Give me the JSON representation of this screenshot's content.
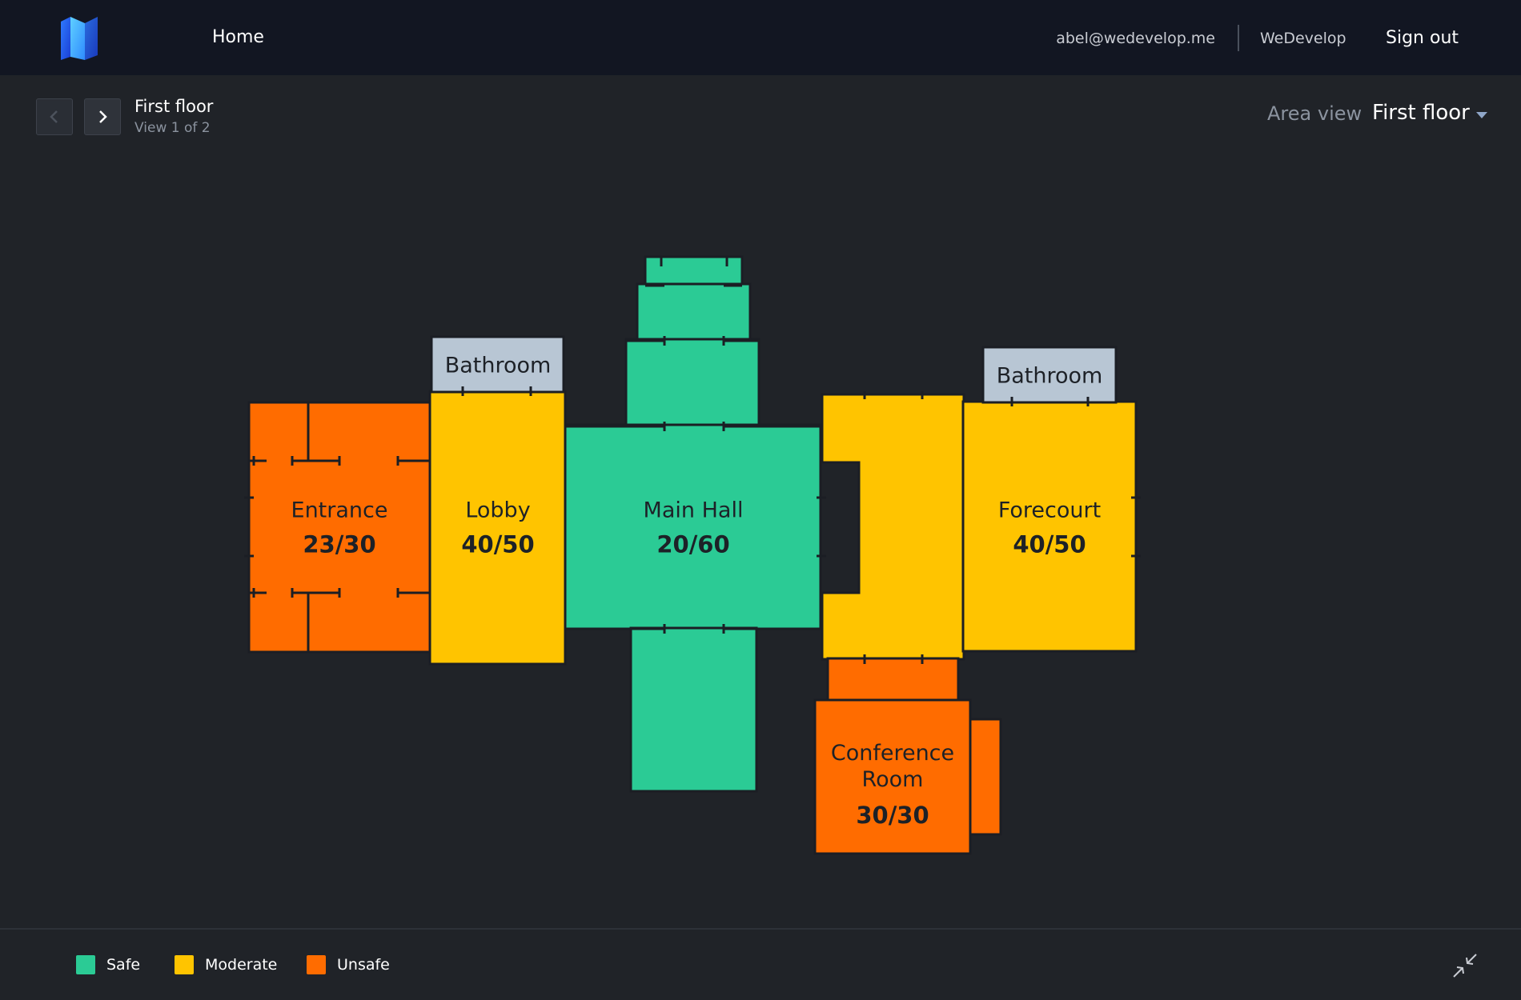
{
  "header": {
    "nav_home": "Home",
    "user_email": "abel@wedevelop.me",
    "org_name": "WeDevelop",
    "sign_out": "Sign out"
  },
  "floor_nav": {
    "title": "First floor",
    "subtitle": "View 1 of 2",
    "area_view_label": "Area view",
    "selected_floor": "First floor"
  },
  "colors": {
    "safe": "#2bcb95",
    "moderate": "#ffc400",
    "unsafe": "#ff6c00",
    "bathroom": "#b8c6d4",
    "background": "#202328",
    "topbar": "#121622"
  },
  "rooms": [
    {
      "id": "entrance",
      "name": "Entrance",
      "count": "23/30",
      "status": "unsafe"
    },
    {
      "id": "lobby",
      "name": "Lobby",
      "count": "40/50",
      "status": "moderate"
    },
    {
      "id": "main-hall",
      "name": "Main Hall",
      "count": "20/60",
      "status": "safe"
    },
    {
      "id": "forecourt",
      "name": "Forecourt",
      "count": "40/50",
      "status": "moderate"
    },
    {
      "id": "conference-room",
      "name": "Conference Room",
      "name_line1": "Conference",
      "name_line2": "Room",
      "count": "30/30",
      "status": "unsafe"
    },
    {
      "id": "bathroom-left",
      "name": "Bathroom",
      "status": "neutral"
    },
    {
      "id": "bathroom-right",
      "name": "Bathroom",
      "status": "neutral"
    }
  ],
  "legend": [
    {
      "label": "Safe",
      "color": "#2bcb95"
    },
    {
      "label": "Moderate",
      "color": "#ffc400"
    },
    {
      "label": "Unsafe",
      "color": "#ff6c00"
    }
  ],
  "icons": {
    "logo": "map-logo-icon",
    "prev": "chevron-left-icon",
    "next": "chevron-right-icon",
    "dropdown": "caret-down-icon",
    "collapse": "collapse-arrows-icon"
  }
}
